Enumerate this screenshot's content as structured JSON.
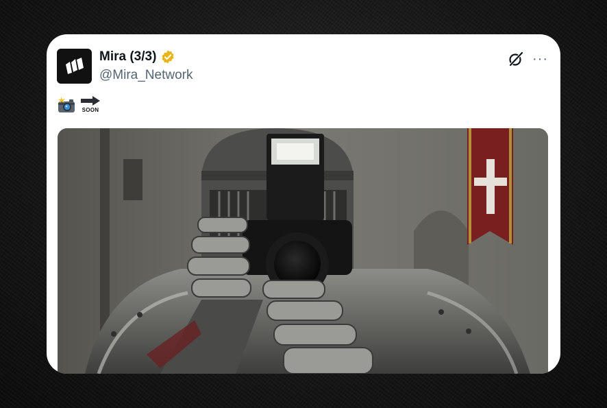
{
  "tweet": {
    "author_name": "Mira (3/3)",
    "handle": "@Mira_Network",
    "avatar_icon": "mira-logo-icon",
    "verified_icon": "verified-badge-icon",
    "verified_color": "#e8b516",
    "actions": {
      "grok_icon": "grok-icon",
      "more_label": "···"
    },
    "content": {
      "emoji_1": "camera-with-flash-emoji",
      "emoji_2": "soon-arrow-emoji",
      "soon_label": "SOON"
    },
    "media": {
      "description_icon": "knight-with-camera-image"
    }
  }
}
